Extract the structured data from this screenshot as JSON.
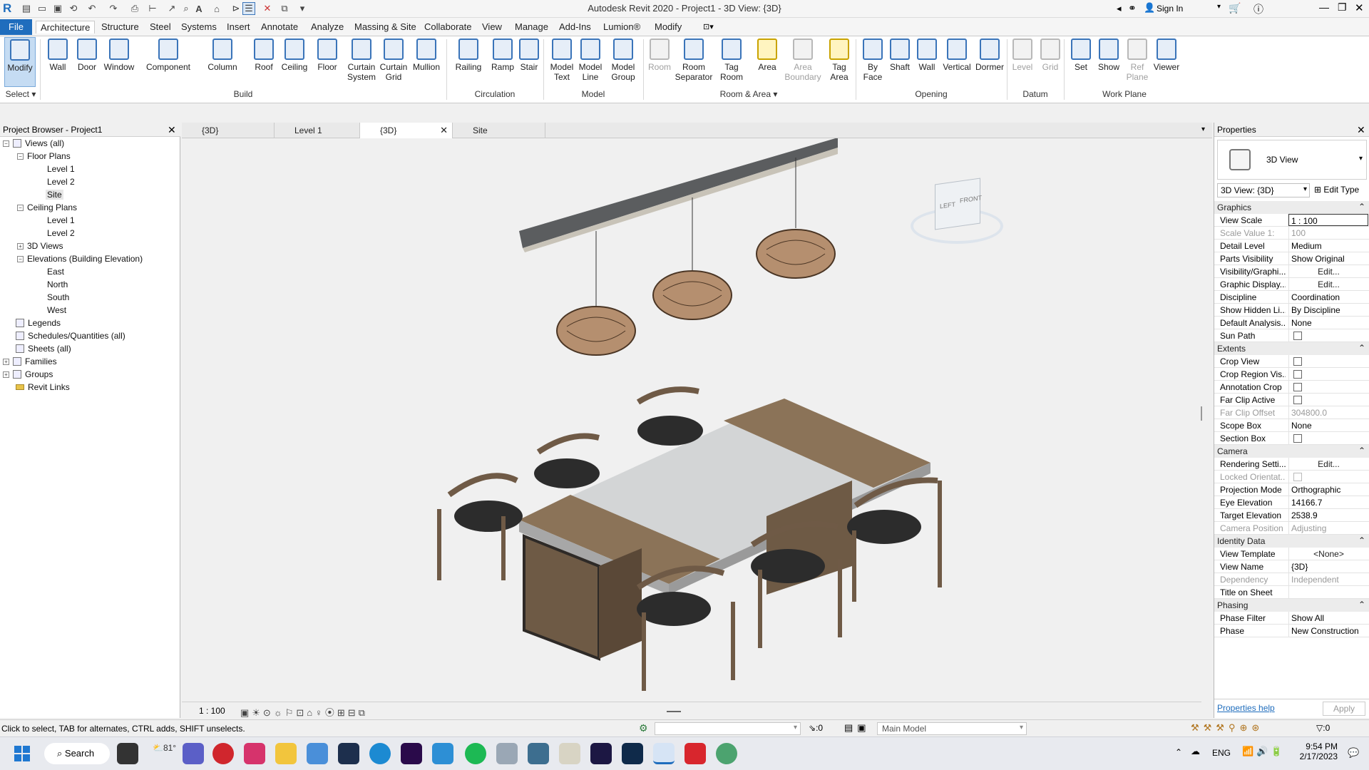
{
  "app": {
    "title": "Autodesk Revit 2020 - Project1 - 3D View: {3D}",
    "sign_in": "Sign In"
  },
  "menus": [
    "File",
    "Architecture",
    "Structure",
    "Steel",
    "Systems",
    "Insert",
    "Annotate",
    "Analyze",
    "Massing & Site",
    "Collaborate",
    "View",
    "Manage",
    "Add-Ins",
    "Lumion®",
    "Modify"
  ],
  "ribbon": {
    "tools": [
      {
        "label": "Modify",
        "line2": ""
      },
      {
        "label": "Wall",
        "line2": ""
      },
      {
        "label": "Door",
        "line2": ""
      },
      {
        "label": "Window",
        "line2": ""
      },
      {
        "label": "Component",
        "line2": ""
      },
      {
        "label": "Column",
        "line2": ""
      },
      {
        "label": "Roof",
        "line2": ""
      },
      {
        "label": "Ceiling",
        "line2": ""
      },
      {
        "label": "Floor",
        "line2": ""
      },
      {
        "label": "Curtain",
        "line2": "System"
      },
      {
        "label": "Curtain",
        "line2": "Grid"
      },
      {
        "label": "Mullion",
        "line2": ""
      },
      {
        "label": "Railing",
        "line2": ""
      },
      {
        "label": "Ramp",
        "line2": ""
      },
      {
        "label": "Stair",
        "line2": ""
      },
      {
        "label": "Model",
        "line2": "Text"
      },
      {
        "label": "Model",
        "line2": "Line"
      },
      {
        "label": "Model",
        "line2": "Group"
      },
      {
        "label": "Room",
        "line2": ""
      },
      {
        "label": "Room",
        "line2": "Separator"
      },
      {
        "label": "Tag",
        "line2": "Room"
      },
      {
        "label": "Area",
        "line2": ""
      },
      {
        "label": "Area",
        "line2": "Boundary"
      },
      {
        "label": "Tag",
        "line2": "Area"
      },
      {
        "label": "By",
        "line2": "Face"
      },
      {
        "label": "Shaft",
        "line2": ""
      },
      {
        "label": "Wall",
        "line2": ""
      },
      {
        "label": "Vertical",
        "line2": ""
      },
      {
        "label": "Dormer",
        "line2": ""
      },
      {
        "label": "Level",
        "line2": ""
      },
      {
        "label": "Grid",
        "line2": ""
      },
      {
        "label": "Set",
        "line2": ""
      },
      {
        "label": "Show",
        "line2": ""
      },
      {
        "label": "Ref",
        "line2": "Plane"
      },
      {
        "label": "Viewer",
        "line2": ""
      }
    ],
    "panels": [
      "Select",
      "Build",
      "Circulation",
      "Model",
      "Room & Area",
      "Opening",
      "Datum",
      "Work Plane"
    ]
  },
  "browser": {
    "title": "Project Browser - Project1",
    "nodes": [
      "Views (all)",
      "Floor Plans",
      "Level 1",
      "Level 2",
      "Site",
      "Ceiling Plans",
      "Level 1",
      "Level 2",
      "3D Views",
      "Elevations (Building Elevation)",
      "East",
      "North",
      "South",
      "West",
      "Legends",
      "Schedules/Quantities (all)",
      "Sheets (all)",
      "Families",
      "Groups",
      "Revit Links"
    ]
  },
  "view_tabs": [
    "{3D}",
    "Level 1",
    "{3D}",
    "Site"
  ],
  "viewcube": {
    "left": "LEFT",
    "front": "FRONT"
  },
  "view_bar": {
    "scale": "1 : 100"
  },
  "properties": {
    "title": "Properties",
    "type": "3D View",
    "selector": "3D View: {3D}",
    "edit_type": "Edit Type",
    "sections": [
      {
        "name": "Graphics",
        "rows": [
          [
            "View Scale",
            "1 : 100"
          ],
          [
            "Scale Value    1:",
            "100"
          ],
          [
            "Detail Level",
            "Medium"
          ],
          [
            "Parts Visibility",
            "Show Original"
          ],
          [
            "Visibility/Graphi...",
            "Edit..."
          ],
          [
            "Graphic Display...",
            "Edit..."
          ],
          [
            "Discipline",
            "Coordination"
          ],
          [
            "Show Hidden Li...",
            "By Discipline"
          ],
          [
            "Default Analysis...",
            "None"
          ],
          [
            "Sun Path",
            ""
          ]
        ]
      },
      {
        "name": "Extents",
        "rows": [
          [
            "Crop View",
            ""
          ],
          [
            "Crop Region Vis...",
            ""
          ],
          [
            "Annotation Crop",
            ""
          ],
          [
            "Far Clip Active",
            ""
          ],
          [
            "Far Clip Offset",
            "304800.0"
          ],
          [
            "Scope Box",
            "None"
          ],
          [
            "Section Box",
            ""
          ]
        ]
      },
      {
        "name": "Camera",
        "rows": [
          [
            "Rendering Setti...",
            "Edit..."
          ],
          [
            "Locked Orientat...",
            ""
          ],
          [
            "Projection Mode",
            "Orthographic"
          ],
          [
            "Eye Elevation",
            "14166.7"
          ],
          [
            "Target Elevation",
            "2538.9"
          ],
          [
            "Camera Position",
            "Adjusting"
          ]
        ]
      },
      {
        "name": "Identity Data",
        "rows": [
          [
            "View Template",
            "<None>"
          ],
          [
            "View Name",
            "{3D}"
          ],
          [
            "Dependency",
            "Independent"
          ],
          [
            "Title on Sheet",
            ""
          ]
        ]
      },
      {
        "name": "Phasing",
        "rows": [
          [
            "Phase Filter",
            "Show All"
          ],
          [
            "Phase",
            "New Construction"
          ]
        ]
      }
    ],
    "help": "Properties help",
    "apply": "Apply"
  },
  "status": {
    "hint": "Click to select, TAB for alternates, CTRL adds, SHIFT unselects.",
    "count": ":0",
    "model": "Main Model",
    "filter": ":0"
  },
  "taskbar": {
    "search": "Search",
    "temp": "81°",
    "lang": "ENG",
    "time": "9:54 PM",
    "date": "2/17/2023"
  }
}
